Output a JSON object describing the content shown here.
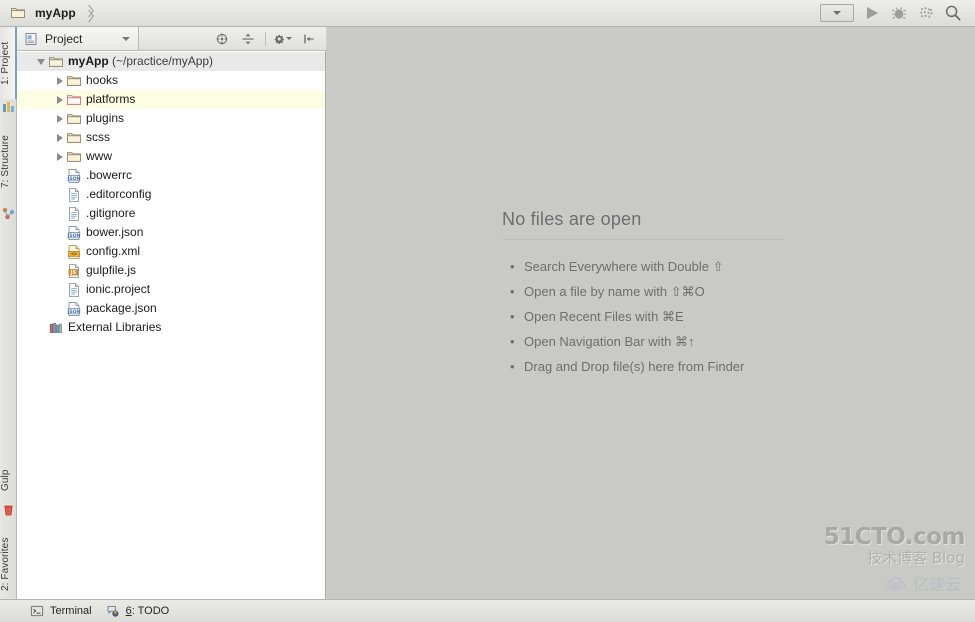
{
  "window": {
    "breadcrumb": {
      "project_name": "myApp",
      "folder_icon": "folder-icon",
      "separator_icon": "chevron-right-icon"
    },
    "nav_right": {
      "run_config_icon": "chevron-down-icon",
      "run_icon": "run-play-icon",
      "debug_icon": "debug-bug-icon",
      "coverage_icon": "run-with-coverage-icon",
      "search_icon": "search-icon"
    }
  },
  "toolstrip": {
    "tabs": [
      {
        "index": "1",
        "label": "1: Project",
        "icon": "project-icon",
        "active": true
      },
      {
        "index": "7",
        "label": "7: Structure",
        "icon": "structure-icon",
        "active": false
      },
      {
        "index": "",
        "label": "Gulp",
        "icon": "gulp-icon",
        "active": false
      },
      {
        "index": "2",
        "label": "2: Favorites",
        "icon": "favorites-star-icon",
        "active": false
      }
    ]
  },
  "project_panel": {
    "tab_label": "Project",
    "tab_icon": "project-view-icon",
    "tab_dropdown_icon": "chevron-down-icon",
    "toolbar": [
      {
        "name": "scroll-from-source-icon",
        "title": ""
      },
      {
        "name": "collapse-all-icon",
        "title": ""
      },
      {
        "name": "settings-gear-icon",
        "title": ""
      },
      {
        "name": "hide-panel-icon",
        "title": ""
      }
    ],
    "tree": [
      {
        "label": "myApp",
        "suffix": " (~/practice/myApp)",
        "icon": "folder-icon",
        "indent": 0,
        "arrow": "open",
        "bold": true,
        "state": "selected"
      },
      {
        "label": "hooks",
        "suffix": "",
        "icon": "folder-icon",
        "indent": 1,
        "arrow": "closed",
        "bold": false,
        "state": "normal"
      },
      {
        "label": "platforms",
        "suffix": "",
        "icon": "folder-excluded-icon",
        "indent": 1,
        "arrow": "closed",
        "bold": false,
        "state": "highlighted"
      },
      {
        "label": "plugins",
        "suffix": "",
        "icon": "folder-icon",
        "indent": 1,
        "arrow": "closed",
        "bold": false,
        "state": "normal"
      },
      {
        "label": "scss",
        "suffix": "",
        "icon": "folder-icon",
        "indent": 1,
        "arrow": "closed",
        "bold": false,
        "state": "normal"
      },
      {
        "label": "www",
        "suffix": "",
        "icon": "folder-icon",
        "indent": 1,
        "arrow": "closed",
        "bold": false,
        "state": "normal"
      },
      {
        "label": ".bowerrc",
        "suffix": "",
        "icon": "json-file-icon",
        "indent": 1,
        "arrow": "none",
        "bold": false,
        "state": "normal"
      },
      {
        "label": ".editorconfig",
        "suffix": "",
        "icon": "text-file-icon",
        "indent": 1,
        "arrow": "none",
        "bold": false,
        "state": "normal"
      },
      {
        "label": ".gitignore",
        "suffix": "",
        "icon": "text-file-icon",
        "indent": 1,
        "arrow": "none",
        "bold": false,
        "state": "normal"
      },
      {
        "label": "bower.json",
        "suffix": "",
        "icon": "json-file-icon",
        "indent": 1,
        "arrow": "none",
        "bold": false,
        "state": "normal"
      },
      {
        "label": "config.xml",
        "suffix": "",
        "icon": "xml-file-icon",
        "indent": 1,
        "arrow": "none",
        "bold": false,
        "state": "normal"
      },
      {
        "label": "gulpfile.js",
        "suffix": "",
        "icon": "js-file-icon",
        "indent": 1,
        "arrow": "none",
        "bold": false,
        "state": "normal"
      },
      {
        "label": "ionic.project",
        "suffix": "",
        "icon": "text-file-icon",
        "indent": 1,
        "arrow": "none",
        "bold": false,
        "state": "normal"
      },
      {
        "label": "package.json",
        "suffix": "",
        "icon": "json-file-icon",
        "indent": 1,
        "arrow": "none",
        "bold": false,
        "state": "normal"
      },
      {
        "label": "External Libraries",
        "suffix": "",
        "icon": "libraries-icon",
        "indent": 0,
        "arrow": "none",
        "bold": false,
        "state": "normal"
      }
    ]
  },
  "editor": {
    "empty_title": "No files are open",
    "hints": [
      "Search Everywhere with Double ⇧",
      "Open a file by name with ⇧⌘O",
      "Open Recent Files with ⌘E",
      "Open Navigation Bar with ⌘↑",
      "Drag and Drop file(s) here from Finder"
    ]
  },
  "statusbar": {
    "items": [
      {
        "label": "Terminal",
        "icon": "terminal-icon",
        "underline_prefix": ""
      },
      {
        "label": "6: TODO",
        "icon": "todo-icon",
        "underline_prefix": "6"
      }
    ]
  },
  "watermarks": {
    "cto_line1": "51CTO.com",
    "cto_line2": "技术博客  Blog",
    "ysy_text": "亿速云",
    "ysy_icon": "cloud-logo-icon"
  },
  "colors": {
    "panel_bg": "#ffffff",
    "editor_bg": "#c9c9c6",
    "chrome_bg": "#e4e4e0",
    "selection_row": "#e9e9e9",
    "highlight_row": "#fdfde4",
    "hint_text": "#6e6e6e",
    "accent_tab": "#7c9fbd"
  }
}
